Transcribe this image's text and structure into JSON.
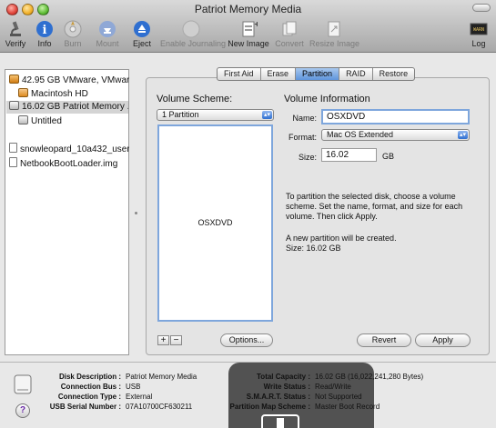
{
  "window": {
    "title": "Patriot Memory Media"
  },
  "toolbar": {
    "items": [
      {
        "label": "Verify",
        "icon": "microscope-icon",
        "enabled": true
      },
      {
        "label": "Info",
        "icon": "info-icon",
        "enabled": true
      },
      {
        "label": "Burn",
        "icon": "burn-icon",
        "enabled": false
      },
      {
        "label": "Mount",
        "icon": "mount-icon",
        "enabled": false
      },
      {
        "label": "Eject",
        "icon": "eject-icon",
        "enabled": true
      },
      {
        "label": "Enable Journaling",
        "icon": "journal-icon",
        "enabled": false
      },
      {
        "label": "New Image",
        "icon": "new-image-icon",
        "enabled": true
      },
      {
        "label": "Convert",
        "icon": "convert-icon",
        "enabled": false
      },
      {
        "label": "Resize Image",
        "icon": "resize-image-icon",
        "enabled": false
      }
    ],
    "log_label": "Log"
  },
  "sidebar": {
    "items": [
      {
        "label": "42.95 GB VMware, VMware..."
      },
      {
        "label": "Macintosh HD"
      },
      {
        "label": "16.02 GB Patriot Memory ..."
      },
      {
        "label": "Untitled"
      },
      {
        "label": "snowleopard_10a432_user..."
      },
      {
        "label": "NetbookBootLoader.img"
      }
    ],
    "selected_index": 2
  },
  "tabs": [
    "First Aid",
    "Erase",
    "Partition",
    "RAID",
    "Restore"
  ],
  "active_tab": "Partition",
  "partition": {
    "scheme_heading": "Volume Scheme:",
    "scheme_value": "1 Partition",
    "scheme_partition_name": "OSXDVD",
    "info_heading": "Volume Information",
    "name_label": "Name:",
    "name_value": "OSXDVD",
    "format_label": "Format:",
    "format_value": "Mac OS Extended",
    "size_label": "Size:",
    "size_value": "16.02",
    "size_unit": "GB",
    "instructions": "To partition the selected disk, choose a volume scheme. Set the name, format, and size for each volume. Then click Apply.",
    "status_line1": "A new partition will be created.",
    "status_line2": "Size: 16.02 GB",
    "add_symbol": "+",
    "remove_symbol": "−",
    "options_label": "Options...",
    "revert_label": "Revert",
    "apply_label": "Apply"
  },
  "details": {
    "left": [
      {
        "key": "Disk Description :",
        "value": "Patriot Memory Media"
      },
      {
        "key": "Connection Bus :",
        "value": "USB"
      },
      {
        "key": "Connection Type :",
        "value": "External"
      },
      {
        "key": "USB Serial Number :",
        "value": "07A10700CF630211"
      }
    ],
    "right": [
      {
        "key": "Total Capacity :",
        "value": "16.02 GB (16,022,241,280 Bytes)"
      },
      {
        "key": "Write Status :",
        "value": "Read/Write"
      },
      {
        "key": "S.M.A.R.T. Status :",
        "value": "Not Supported"
      },
      {
        "key": "Partition Map Scheme :",
        "value": "Master Boot Record"
      }
    ]
  },
  "help_symbol": "?"
}
